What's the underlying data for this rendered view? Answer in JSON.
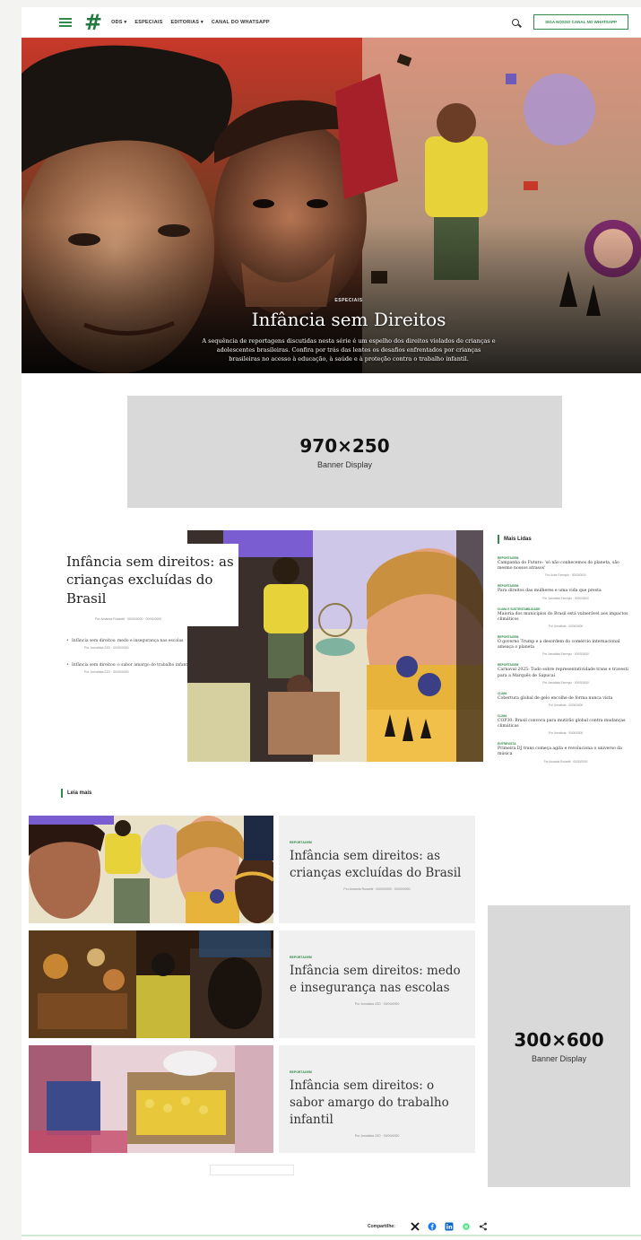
{
  "header": {
    "nav": [
      "ODS ▾",
      "ESPECIAIS",
      "EDITORIAS ▾",
      "CANAL DO WHATSAPP"
    ],
    "cta": "SIGA NOSSO CANAL NO WHATSAPP"
  },
  "hero": {
    "tag": "ESPECIAIS",
    "title": "Infância sem Direitos",
    "description": "A sequência de reportagens discutidas nesta série é um espelho dos direitos violados de crianças e adolescentes brasileiras. Confira por trás das lentes os desafios enfrentados por crianças brasileiras no acesso à educação, à saúde e à proteção contra o trabalho infantil."
  },
  "banner_top": {
    "size": "970×250",
    "label": "Banner Display"
  },
  "banner_side": {
    "size": "300×600",
    "label": "Banner Display"
  },
  "featured": {
    "title": "Infância sem direitos: as crianças excluídas do Brasil",
    "meta": "Por Amanda Rossetti · 00/00/0000 · 00/00/0000",
    "related": [
      {
        "title": "Infância sem direitos: medo e insegurança nas escolas",
        "meta": "Por Jornalista 2ZD · 00/00/0000"
      },
      {
        "title": "Infância sem direitos: o sabor amargo do trabalho infantil",
        "meta": "Por Jornalista 2ZD · 00/00/0000"
      }
    ]
  },
  "mais_lidas": {
    "heading": "Mais Lidas",
    "items": [
      {
        "tag": "Reportagem",
        "title": "Campanha do Futuro: 'só não conhecemos do planeta, são mesmo nossos atrasos'",
        "meta": "Por Autor Exemplo · 00/00/0000"
      },
      {
        "tag": "Reportagem",
        "title": "Para direitos das mulheres e uma vida que presta",
        "meta": "Por Jornalista Exemplo · 00/00/0000"
      },
      {
        "tag": "Clima e sustentabilidade",
        "title": "Maioria dos municípios do Brasil está vulnerável aos impactos climáticos",
        "meta": "Por Jornalista · 00/00/0000"
      },
      {
        "tag": "Reportagem",
        "title": "O governo Trump e a desordem do comércio internacional ameaça o planeta",
        "meta": "Por Jornalista Exemplo · 00/00/0000"
      },
      {
        "tag": "Reportagem",
        "title": "Carnaval 2025: Tudo sobre representatividade trans e travesti para a Marquês de Sapucaí",
        "meta": "Por Jornalista Exemplo · 00/00/0000"
      },
      {
        "tag": "Clima",
        "title": "Cobertura global de gelo encolhe de forma nunca vista",
        "meta": "Por Jornalista · 00/00/0000"
      },
      {
        "tag": "Clima",
        "title": "COP30: Brasil convoca para mutirão global contra mudanças climáticas",
        "meta": "Por Jornalista · 00/00/0000"
      },
      {
        "tag": "Entrevista",
        "title": "Primeira DJ trans começa agita e revoluciona o universo da música",
        "meta": "Por Amanda Rossetti · 00/00/0000"
      }
    ]
  },
  "leia_mais": {
    "heading": "Leia mais",
    "cards": [
      {
        "tag": "Reportagem",
        "title": "Infância sem direitos: as crianças excluídas do Brasil",
        "meta": "Por Amanda Rossetti · 00/00/0000 · 00/00/0000"
      },
      {
        "tag": "Reportagem",
        "title": "Infância sem direitos: medo e insegurança nas escolas",
        "meta": "Por Jornalista 2ZD · 00/00/0000"
      },
      {
        "tag": "Reportagem",
        "title": "Infância sem direitos: o sabor amargo do trabalho infantil",
        "meta": "Por Jornalista 2ZD · 00/00/0000"
      }
    ]
  },
  "share": {
    "label": "Compartilhe:"
  },
  "colors": {
    "accent": "#2f8a4c",
    "banner": "#d9d9d9",
    "hero_red": "#c8382a"
  }
}
